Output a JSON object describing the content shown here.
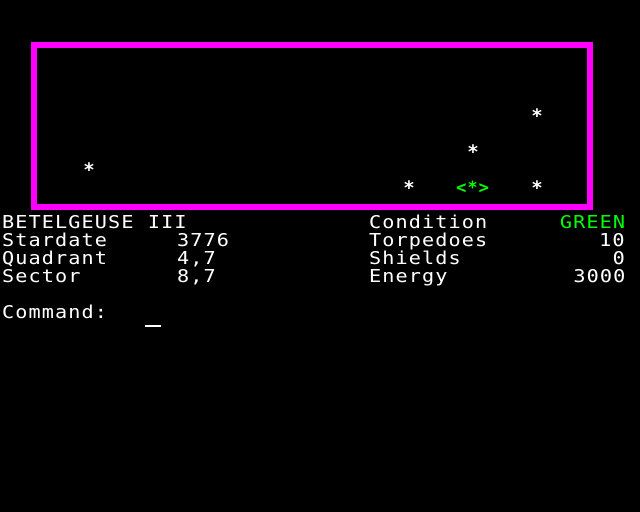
{
  "scanner": {
    "stars": [
      "*",
      "*",
      "*",
      "*",
      "*"
    ],
    "ship": "<*>"
  },
  "status": {
    "ship_name": "BETELGEUSE III",
    "stardate_label": "Stardate",
    "stardate_value": "3776",
    "quadrant_label": "Quadrant",
    "quadrant_value": "4,7",
    "sector_label": "Sector",
    "sector_value": "8,7",
    "condition_label": "Condition",
    "condition_value": "GREEN",
    "torpedoes_label": "Torpedoes",
    "torpedoes_value": "10",
    "shields_label": "Shields",
    "shields_value": "0",
    "energy_label": "Energy",
    "energy_value": "3000"
  },
  "command": {
    "prompt": "Command:"
  },
  "colors": {
    "background": "#000000",
    "border": "#ff00ff",
    "text": "#ffffff",
    "condition_green": "#00ff00"
  }
}
